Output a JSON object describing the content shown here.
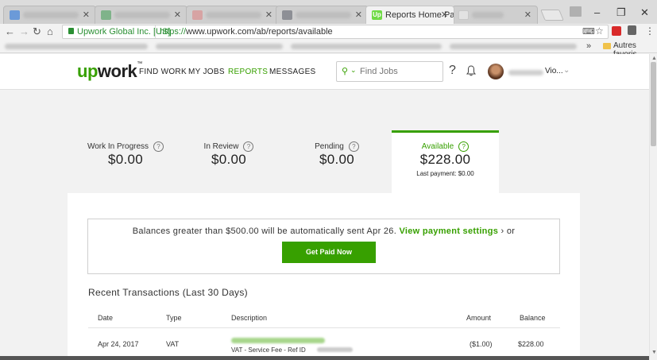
{
  "browser": {
    "tabs": [
      {
        "title": "",
        "active": false
      },
      {
        "title": "",
        "active": false
      },
      {
        "title": "",
        "active": false
      },
      {
        "title": "",
        "active": false
      },
      {
        "title": "Reports Home Page",
        "favicon": "Up",
        "active": true
      },
      {
        "title": "",
        "active": false
      }
    ],
    "secure_label": "Upwork Global Inc. [US]",
    "url_protocol": "https://",
    "url_rest": "www.upwork.com/ab/reports/available",
    "bookmarks_folder": "Autres favoris"
  },
  "header": {
    "logo_up": "up",
    "logo_rest": "work",
    "nav": [
      "FIND WORK",
      "MY JOBS",
      "REPORTS",
      "MESSAGES"
    ],
    "active_nav": "REPORTS",
    "search_placeholder": "Find Jobs",
    "user_name": "Vio..."
  },
  "balances": [
    {
      "label": "Work In Progress",
      "amount": "$0.00"
    },
    {
      "label": "In Review",
      "amount": "$0.00"
    },
    {
      "label": "Pending",
      "amount": "$0.00"
    },
    {
      "label": "Available",
      "amount": "$228.00",
      "note": "Last payment: $0.00"
    }
  ],
  "notice": {
    "text": "Balances greater than $500.00 will be automatically sent Apr 26.",
    "link": "View payment settings",
    "suffix": "› or",
    "button": "Get Paid Now"
  },
  "transactions": {
    "title": "Recent Transactions (Last 30 Days)",
    "columns": [
      "Date",
      "Type",
      "Description",
      "Amount",
      "Balance"
    ],
    "rows": [
      {
        "date": "Apr 24, 2017",
        "type": "VAT",
        "description": "VAT - Service Fee - Ref ID",
        "amount": "($1.00)",
        "balance": "$228.00"
      }
    ]
  },
  "colors": {
    "brand_green": "#37a000",
    "upwork_logo_green": "#6fda44"
  }
}
